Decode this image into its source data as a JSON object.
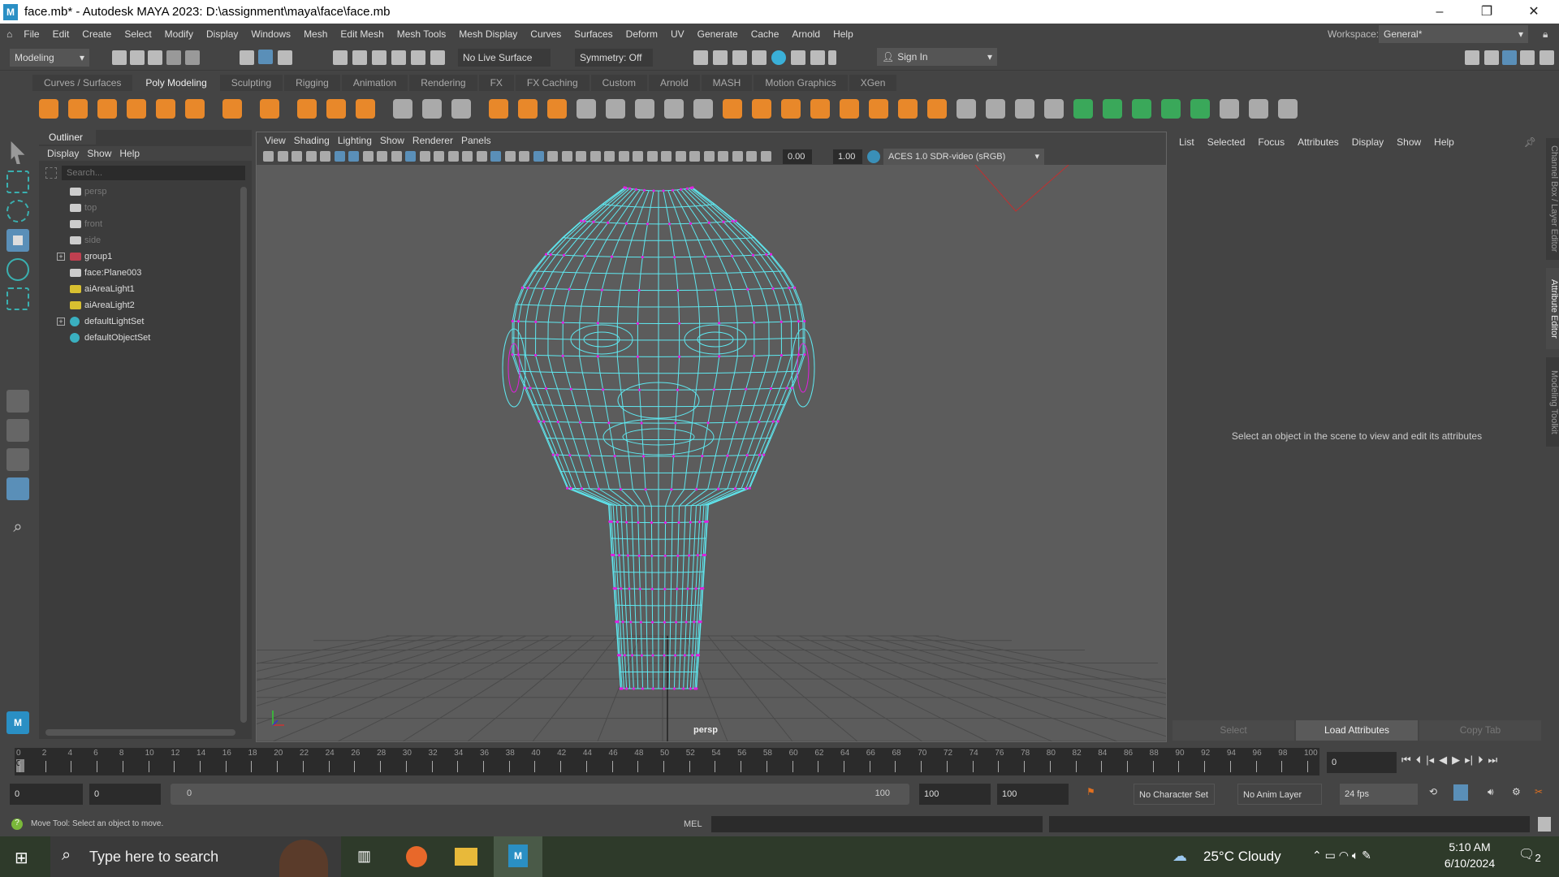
{
  "title": "face.mb* - Autodesk MAYA 2023: D:\\assignment\\maya\\face\\face.mb",
  "menus": [
    "File",
    "Edit",
    "Create",
    "Select",
    "Modify",
    "Display",
    "Windows",
    "Mesh",
    "Edit Mesh",
    "Mesh Tools",
    "Mesh Display",
    "Curves",
    "Surfaces",
    "Deform",
    "UV",
    "Generate",
    "Cache",
    "Arnold",
    "Help"
  ],
  "workspace": {
    "label": "Workspace:",
    "value": "General*"
  },
  "statusline": {
    "menuset": "Modeling",
    "live_surface": "No Live Surface",
    "symmetry": "Symmetry: Off",
    "sign_in": "Sign In"
  },
  "shelf_tabs": [
    "Curves / Surfaces",
    "Poly Modeling",
    "Sculpting",
    "Rigging",
    "Animation",
    "Rendering",
    "FX",
    "FX Caching",
    "Custom",
    "Arnold",
    "MASH",
    "Motion Graphics",
    "XGen"
  ],
  "shelf_active": "Poly Modeling",
  "outliner": {
    "tab": "Outliner",
    "menus": [
      "Display",
      "Show",
      "Help"
    ],
    "search_placeholder": "Search...",
    "items": [
      {
        "label": "persp",
        "type": "camera",
        "dim": true
      },
      {
        "label": "top",
        "type": "camera",
        "dim": true
      },
      {
        "label": "front",
        "type": "camera",
        "dim": true
      },
      {
        "label": "side",
        "type": "camera",
        "dim": true
      },
      {
        "label": "group1",
        "type": "group",
        "expand": true
      },
      {
        "label": "face:Plane003",
        "type": "mesh"
      },
      {
        "label": "aiAreaLight1",
        "type": "light"
      },
      {
        "label": "aiAreaLight2",
        "type": "light"
      },
      {
        "label": "defaultLightSet",
        "type": "set",
        "expand": true
      },
      {
        "label": "defaultObjectSet",
        "type": "set"
      }
    ]
  },
  "viewport": {
    "menus": [
      "View",
      "Shading",
      "Lighting",
      "Show",
      "Renderer",
      "Panels"
    ],
    "exposure": "0.00",
    "gamma": "1.00",
    "colorspace": "ACES 1.0 SDR-video (sRGB)",
    "camera": "persp",
    "wire_color": "#5fe8f0",
    "vertex_color": "#e020e0"
  },
  "attribute_editor": {
    "menus": [
      "List",
      "Selected",
      "Focus",
      "Attributes",
      "Display",
      "Show",
      "Help"
    ],
    "message": "Select an object in the scene to view and edit its attributes",
    "buttons": [
      "Select",
      "Load Attributes",
      "Copy Tab"
    ]
  },
  "side_tabs": [
    "Channel Box / Layer Editor",
    "Attribute Editor",
    "Modeling Toolkit"
  ],
  "timeline": {
    "start": 0,
    "end": 100,
    "step": 2,
    "current": "0",
    "current_field": "0"
  },
  "range": {
    "start": "0",
    "inner_start": "0",
    "slider_start": "0",
    "slider_end": "100",
    "inner_end": "100",
    "end": "100",
    "character_set": "No Character Set",
    "anim_layer": "No Anim Layer",
    "fps": "24 fps"
  },
  "helpline": {
    "message": "Move Tool: Select an object to move.",
    "cmd_lang": "MEL"
  },
  "taskbar": {
    "search": "Type here to search",
    "weather": "25°C  Cloudy",
    "time": "5:10 AM",
    "date": "6/10/2024",
    "notifications": "2"
  }
}
